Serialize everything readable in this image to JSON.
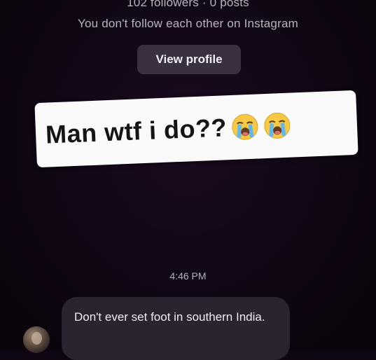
{
  "profile_header": {
    "stats": "102 followers · 0 posts",
    "relationship": "You don't follow each other on Instagram",
    "view_profile_label": "View profile"
  },
  "caption": {
    "text": "Man wtf i do??",
    "emojis": [
      "loudly-crying-face-icon",
      "loudly-crying-face-icon"
    ]
  },
  "thread": {
    "timestamp": "4:46 PM",
    "messages": [
      {
        "sender": "other",
        "text": "Don't ever set foot in southern India."
      }
    ]
  },
  "colors": {
    "background": "#100613",
    "button_bg": "#3a3040",
    "bubble_bg": "#2b2430",
    "caption_bg": "#fafafa"
  }
}
